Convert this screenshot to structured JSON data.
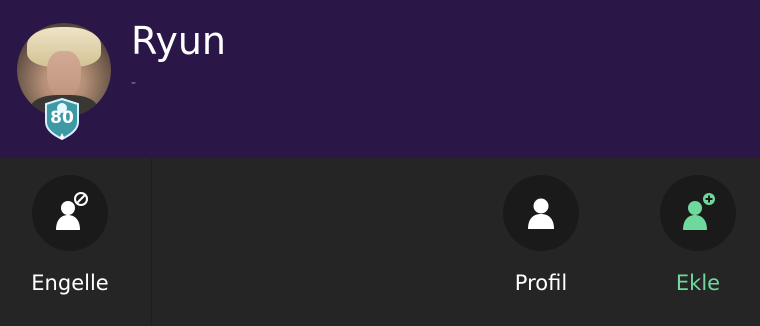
{
  "profile": {
    "name": "Ryun",
    "status": "-",
    "level": "80"
  },
  "actions": {
    "block": {
      "label": "Engelle",
      "icon": "block-user-icon"
    },
    "profile": {
      "label": "Profil",
      "icon": "user-icon"
    },
    "add": {
      "label": "Ekle",
      "icon": "add-user-icon"
    }
  },
  "colors": {
    "header_bg": "#2b1747",
    "panel_bg": "#252525",
    "circle_bg": "#1a1a1a",
    "accent_green": "#6fd89c",
    "badge_teal": "#3d9aa5"
  }
}
